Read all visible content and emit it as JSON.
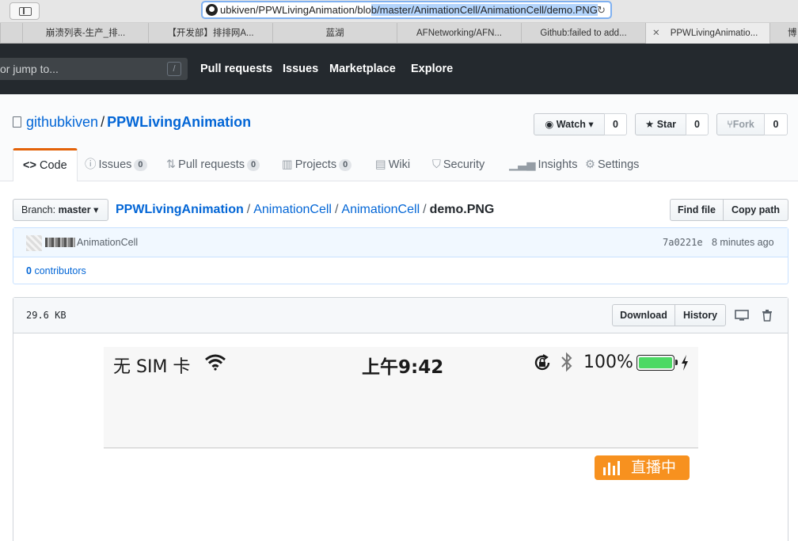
{
  "browser": {
    "url_plain": "ubkiven/PPWLivingAnimation/blo",
    "url_selected": "b/master/AnimationCell/AnimationCell/demo.PNG",
    "tabs": [
      {
        "label": "崩溃列表-生产_排..."
      },
      {
        "label": "【开发部】排排网A..."
      },
      {
        "label": "蓝湖"
      },
      {
        "label": "AFNetworking/AFN..."
      },
      {
        "label": "Github:failed to add..."
      },
      {
        "label": "PPWLivingAnimatio..."
      },
      {
        "label": "博"
      }
    ]
  },
  "header": {
    "search_placeholder": "or jump to...",
    "search_hint": "/",
    "nav": [
      "Pull requests",
      "Issues",
      "Marketplace",
      "Explore"
    ]
  },
  "repo": {
    "owner": "githubkiven",
    "separator": "/",
    "name": "PPWLivingAnimation",
    "watch_label": "Watch",
    "watch_count": "0",
    "star_label": "Star",
    "star_count": "0",
    "fork_label": "Fork",
    "fork_count": "0",
    "tabs": [
      {
        "label": "Code"
      },
      {
        "label": "Issues",
        "count": "0"
      },
      {
        "label": "Pull requests",
        "count": "0"
      },
      {
        "label": "Projects",
        "count": "0"
      },
      {
        "label": "Wiki"
      },
      {
        "label": "Security"
      },
      {
        "label": "Insights"
      },
      {
        "label": "Settings"
      }
    ]
  },
  "path": {
    "branch_prefix": "Branch:",
    "branch": "master",
    "root": "PPWLivingAnimation",
    "dir1": "AnimationCell",
    "dir2": "AnimationCell",
    "file": "demo.PNG",
    "sep": "/",
    "find_file": "Find file",
    "copy_path": "Copy path"
  },
  "commit": {
    "message": "AnimationCell",
    "sha": "7a0221e",
    "time": "8 minutes ago",
    "contributors_count": "0",
    "contributors_label": "contributors"
  },
  "file": {
    "size": "29.6 KB",
    "download": "Download",
    "history": "History"
  },
  "phone": {
    "carrier": "无 SIM 卡",
    "time": "上午9:42",
    "battery": "100%",
    "live_label": "直播中"
  },
  "colors": {
    "header_bg": "#24292e",
    "link": "#0366d6",
    "tab_accent": "#e36209",
    "live_badge": "#f7911f",
    "battery_fill": "#4cd964"
  }
}
